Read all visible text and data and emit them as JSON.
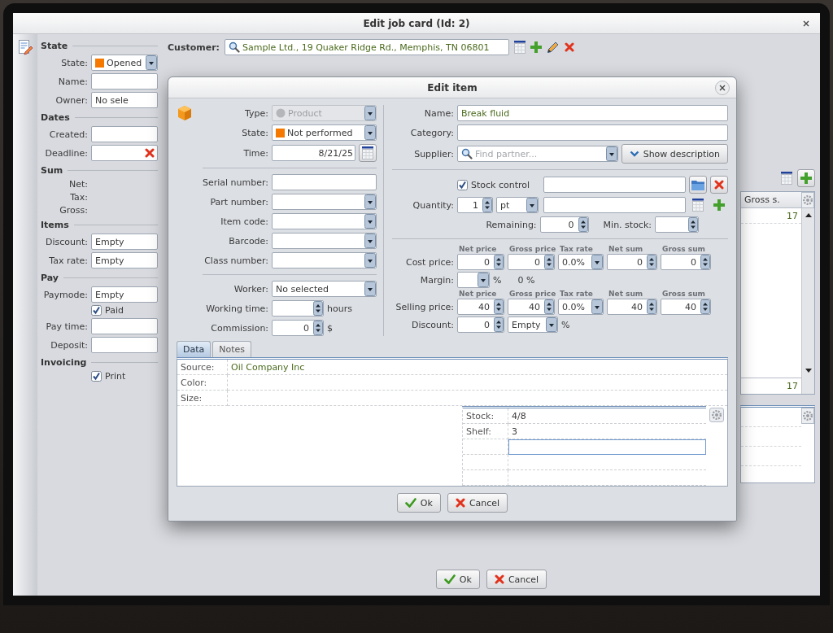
{
  "job_card_window": {
    "title": "Edit job card (Id: 2)",
    "sections": [
      {
        "heading": "State",
        "rows": [
          {
            "kind": "combo",
            "label": "State:",
            "value": "Opened",
            "color": "#f57900"
          },
          {
            "kind": "field",
            "label": "Name:"
          },
          {
            "kind": "field",
            "label": "Owner:",
            "value": "No sele"
          }
        ]
      },
      {
        "heading": "Dates",
        "rows": [
          {
            "kind": "field",
            "label": "Created:"
          },
          {
            "kind": "field",
            "label": "Deadline:",
            "clear_button": true
          }
        ]
      },
      {
        "heading": "Sum",
        "rows": [
          {
            "kind": "text",
            "label": "Net:"
          },
          {
            "kind": "text",
            "label": "Tax:"
          },
          {
            "kind": "text",
            "label": "Gross:"
          }
        ]
      },
      {
        "heading": "Items",
        "rows": [
          {
            "kind": "field",
            "label": "Discount:",
            "value": "Empty"
          },
          {
            "kind": "field",
            "label": "Tax rate:",
            "value": "Empty"
          }
        ]
      },
      {
        "heading": "Pay",
        "rows": [
          {
            "kind": "field",
            "label": "Paymode:",
            "value": "Empty"
          },
          {
            "kind": "checkbox",
            "label": "Paid",
            "checked": true
          },
          {
            "kind": "field",
            "label": "Pay time:"
          },
          {
            "kind": "field",
            "label": "Deposit:"
          }
        ]
      },
      {
        "heading": "Invoicing",
        "rows": [
          {
            "kind": "checkbox",
            "label": "Print",
            "checked": true
          }
        ]
      }
    ],
    "customer": {
      "label": "Customer:",
      "value": "Sample Ltd., 19 Quaker Ridge Rd., Memphis, TN 06801"
    },
    "items_table": {
      "column_header": "Gross s.",
      "rows": [
        "17"
      ],
      "footer": "17"
    },
    "buttons": [
      {
        "kind": "ok",
        "label": "Ok"
      },
      {
        "kind": "cancel",
        "label": "Cancel"
      }
    ]
  },
  "edit_item_dialog": {
    "title": "Edit item",
    "left_groups": [
      [
        {
          "kind": "typecombo",
          "label": "Type:",
          "value": "Product",
          "disabled": true
        },
        {
          "kind": "statecombo",
          "label": "State:",
          "value": "Not performed",
          "color": "#f57900",
          "disabled": false
        },
        {
          "kind": "date",
          "label": "Time:",
          "value": "8/21/25",
          "disabled": false
        }
      ],
      [
        {
          "kind": "field",
          "label": "Serial number:",
          "disabled": false
        },
        {
          "kind": "combo",
          "label": "Part number:",
          "disabled": false
        },
        {
          "kind": "combo",
          "label": "Item code:",
          "disabled": false
        },
        {
          "kind": "combo",
          "label": "Barcode:",
          "disabled": false
        },
        {
          "kind": "combo",
          "label": "Class number:",
          "disabled": false
        }
      ],
      [
        {
          "kind": "combo",
          "label": "Worker:",
          "value": "No selected",
          "disabled": false
        },
        {
          "kind": "spin",
          "label": "Working time:",
          "unit": "hours",
          "disabled": false
        },
        {
          "kind": "spin",
          "label": "Commission:",
          "value": "0",
          "unit": "$",
          "disabled": false
        }
      ]
    ],
    "name": {
      "label": "Name:",
      "value": "Break fluid"
    },
    "category": {
      "label": "Category:"
    },
    "supplier": {
      "label": "Supplier:",
      "placeholder": "Find partner..."
    },
    "show_description_button": "Show description",
    "stock_control": {
      "label": "Stock control",
      "checked": true
    },
    "quantity": {
      "label": "Quantity:",
      "value": "1",
      "unit": "pt"
    },
    "remaining": {
      "label": "Remaining:",
      "value": "0"
    },
    "min_stock": {
      "label": "Min. stock:"
    },
    "price_rows": [
      {
        "kind": "prices",
        "label": "Cost price:",
        "cells": [
          {
            "kind": "spin",
            "caption": "Net price",
            "value": "0"
          },
          {
            "kind": "spin",
            "caption": "Gross price",
            "value": "0"
          },
          {
            "kind": "combo",
            "caption": "Tax rate",
            "value": "0.0%"
          },
          {
            "kind": "spin",
            "caption": "Net sum",
            "value": "0"
          },
          {
            "kind": "spin",
            "caption": "Gross sum",
            "value": "0"
          }
        ]
      },
      {
        "kind": "margin",
        "label": "Margin:",
        "unit": "%",
        "result": "0 %"
      },
      {
        "kind": "prices",
        "label": "Selling price:",
        "cells": [
          {
            "kind": "spin",
            "caption": "Net price",
            "value": "40"
          },
          {
            "kind": "spin",
            "caption": "Gross price",
            "value": "40"
          },
          {
            "kind": "combo",
            "caption": "Tax rate",
            "value": "0.0%"
          },
          {
            "kind": "spin",
            "caption": "Net sum",
            "value": "40"
          },
          {
            "kind": "spin",
            "caption": "Gross sum",
            "value": "40"
          }
        ]
      },
      {
        "kind": "discount",
        "label": "Discount:",
        "value": "0",
        "type": "Empty",
        "unit": "%"
      }
    ],
    "tabs": [
      {
        "label": "Data",
        "selected": true
      },
      {
        "label": "Notes",
        "selected": false
      }
    ],
    "properties": [
      {
        "label": "Source:",
        "value": "Oil Company Inc"
      },
      {
        "label": "Color:"
      },
      {
        "label": "Size:"
      }
    ],
    "stock_properties": [
      {
        "label": "Stock:",
        "value": "4/8",
        "focused": false
      },
      {
        "label": "Shelf:",
        "value": "3",
        "focused": false
      },
      {
        "focused": true
      }
    ],
    "buttons": [
      {
        "kind": "ok",
        "label": "Ok"
      },
      {
        "kind": "cancel",
        "label": "Cancel"
      }
    ]
  }
}
